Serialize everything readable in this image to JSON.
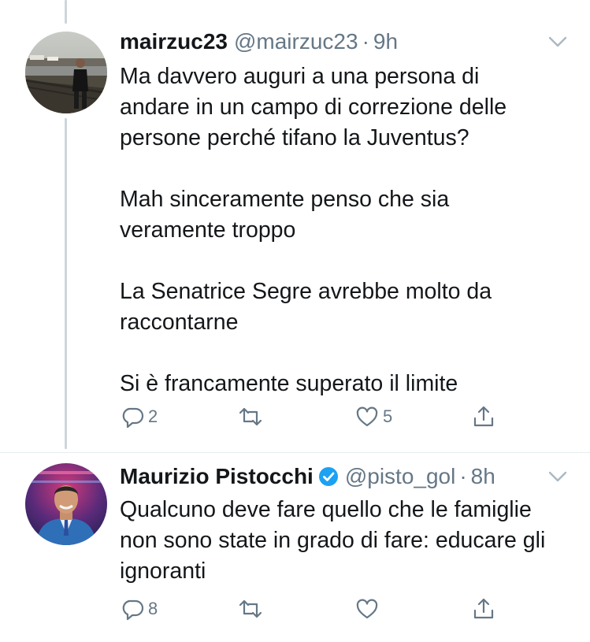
{
  "tweets": [
    {
      "display_name": "mairzuc23",
      "handle": "@mairzuc23",
      "separator": "·",
      "time": "9h",
      "verified": false,
      "paragraphs": [
        "Ma davvero auguri a una persona di andare in un campo di correzione delle persone perché tifano la Juventus?",
        "Mah sinceramente penso che sia veramente troppo",
        "La Senatrice Segre avrebbe molto da raccontarne",
        "Si è francamente superato il limite"
      ],
      "actions": {
        "replies": "2",
        "retweets": "",
        "likes": "5"
      }
    },
    {
      "display_name": "Maurizio Pistocchi",
      "handle": "@pisto_gol",
      "separator": "·",
      "time": "8h",
      "verified": true,
      "paragraphs": [
        "Qualcuno deve fare quello che le famiglie non sono state in grado di fare: educare gli ignoranti"
      ],
      "actions": {
        "replies": "8",
        "retweets": "",
        "likes": ""
      }
    }
  ],
  "icons": {
    "reply": "reply-icon",
    "retweet": "retweet-icon",
    "like": "heart-icon",
    "share": "share-icon",
    "verified": "verified-badge-icon",
    "caret": "chevron-down-icon"
  },
  "colors": {
    "text": "#14171a",
    "secondary": "#657786",
    "verified": "#1da1f2",
    "thread_line": "#ccd6dd",
    "divider": "#e6ecf0"
  }
}
